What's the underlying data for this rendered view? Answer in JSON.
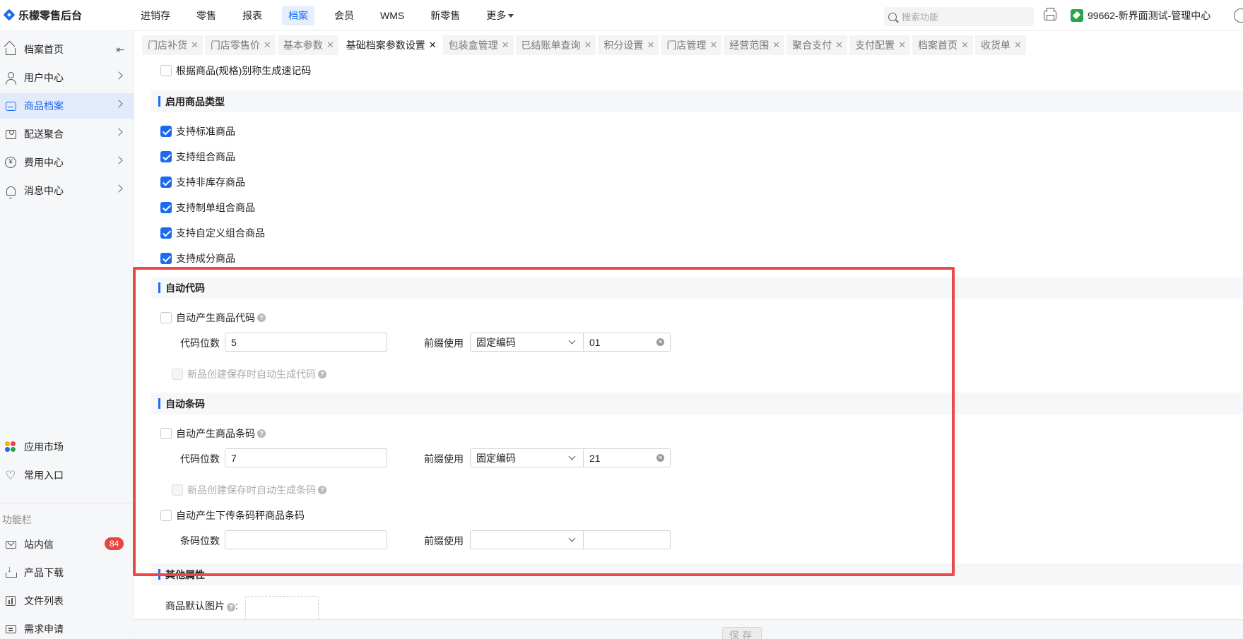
{
  "app": {
    "title": "乐檬零售后台"
  },
  "topnav": [
    {
      "label": "进销存",
      "active": false
    },
    {
      "label": "零售",
      "active": false
    },
    {
      "label": "报表",
      "active": false
    },
    {
      "label": "档案",
      "active": true
    },
    {
      "label": "会员",
      "active": false
    },
    {
      "label": "WMS",
      "active": false
    },
    {
      "label": "新零售",
      "active": false
    },
    {
      "label": "更多",
      "active": false
    }
  ],
  "search": {
    "placeholder": "搜索功能"
  },
  "org": {
    "label": "99662-新界面测试-管理中心"
  },
  "sidebar": {
    "items": [
      {
        "label": "档案首页"
      },
      {
        "label": "用户中心"
      },
      {
        "label": "商品档案"
      },
      {
        "label": "配送聚合"
      },
      {
        "label": "费用中心"
      },
      {
        "label": "消息中心"
      }
    ],
    "bottom": [
      {
        "label": "应用市场"
      },
      {
        "label": "常用入口"
      }
    ],
    "section_label": "功能栏",
    "tools": [
      {
        "label": "站内信",
        "badge": "84"
      },
      {
        "label": "产品下载"
      },
      {
        "label": "文件列表"
      },
      {
        "label": "需求申请"
      }
    ]
  },
  "tabs": [
    {
      "label": "门店补货",
      "active": false
    },
    {
      "label": "门店零售价",
      "active": false
    },
    {
      "label": "基本参数",
      "active": false
    },
    {
      "label": "基础档案参数设置",
      "active": true
    },
    {
      "label": "包装盒管理",
      "active": false
    },
    {
      "label": "已结账单查询",
      "active": false
    },
    {
      "label": "积分设置",
      "active": false
    },
    {
      "label": "门店管理",
      "active": false
    },
    {
      "label": "经营范围",
      "active": false
    },
    {
      "label": "聚合支付",
      "active": false
    },
    {
      "label": "支付配置",
      "active": false
    },
    {
      "label": "档案首页",
      "active": false
    },
    {
      "label": "收货单",
      "active": false
    }
  ],
  "content": {
    "top_option": {
      "label": "根据商品(规格)别称生成速记码",
      "checked": false
    },
    "goods_types": {
      "title": "启用商品类型",
      "options": [
        {
          "label": "支持标准商品",
          "checked": true
        },
        {
          "label": "支持组合商品",
          "checked": true
        },
        {
          "label": "支持非库存商品",
          "checked": true
        },
        {
          "label": "支持制单组合商品",
          "checked": true
        },
        {
          "label": "支持自定义组合商品",
          "checked": true
        },
        {
          "label": "支持成分商品",
          "checked": true
        }
      ]
    },
    "auto_code": {
      "title": "自动代码",
      "enable_label": "自动产生商品代码",
      "digits_label": "代码位数",
      "digits_value": "5",
      "prefix_label": "前缀使用",
      "prefix_mode": "固定编码",
      "prefix_value": "01",
      "new_item_label": "新品创建保存时自动生成代码"
    },
    "auto_barcode": {
      "title": "自动条码",
      "enable_label": "自动产生商品条码",
      "digits_label": "代码位数",
      "digits_value": "7",
      "prefix_label": "前缀使用",
      "prefix_mode": "固定编码",
      "prefix_value": "21",
      "new_item_label": "新品创建保存时自动生成条码",
      "scale_label": "自动产生下传条码秤商品条码",
      "scale_digits_label": "条码位数",
      "scale_digits_value": "",
      "scale_prefix_label": "前缀使用",
      "scale_prefix_mode": "",
      "scale_prefix_value": ""
    },
    "other": {
      "title": "其他属性",
      "default_image_label": "商品默认图片"
    }
  },
  "footer": {
    "save_label": "保存"
  },
  "colors": {
    "accent": "#1a6bf0",
    "highlight": "#ee4747",
    "badge": "#e8463f"
  }
}
